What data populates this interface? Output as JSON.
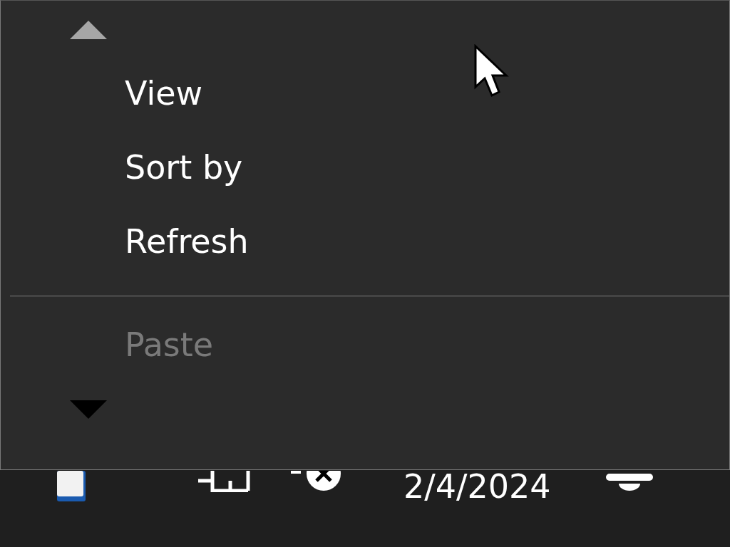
{
  "menu": {
    "scroll_up": {
      "disabled": true
    },
    "items": [
      {
        "kind": "item",
        "label": "View",
        "disabled": false
      },
      {
        "kind": "item",
        "label": "Sort by",
        "disabled": false
      },
      {
        "kind": "item",
        "label": "Refresh",
        "disabled": false
      },
      {
        "kind": "separator"
      },
      {
        "kind": "item",
        "label": "Paste",
        "disabled": true
      }
    ],
    "scroll_down": {
      "disabled": false
    }
  },
  "taskbar": {
    "date": "2/4/2024"
  }
}
